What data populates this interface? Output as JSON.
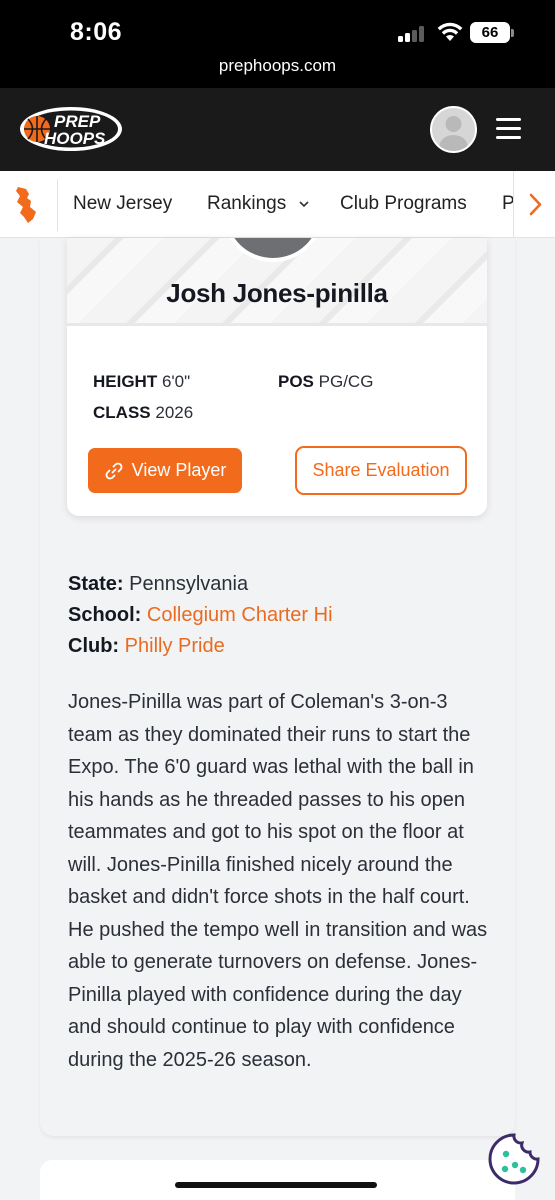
{
  "status_bar": {
    "time": "8:06",
    "url": "prephoops.com",
    "battery": "66"
  },
  "header": {
    "logo_top": "PREP",
    "logo_bottom": "HOOPS",
    "accent_color": "#f26a1b"
  },
  "nav": {
    "items": [
      {
        "label": "New Jersey"
      },
      {
        "label": "Rankings"
      },
      {
        "label": "Club Programs"
      },
      {
        "label": "P"
      }
    ]
  },
  "player": {
    "name": "Josh Jones-pinilla",
    "height_label": "HEIGHT",
    "height_value": "6'0\"",
    "pos_label": "POS",
    "pos_value": "PG/CG",
    "class_label": "CLASS",
    "class_value": "2026",
    "view_button": "View Player",
    "share_button": "Share Evaluation"
  },
  "details": {
    "state_label": "State:",
    "state_value": "Pennsylvania",
    "school_label": "School:",
    "school_value": "Collegium Charter Hi",
    "club_label": "Club:",
    "club_value": "Philly Pride"
  },
  "evaluation": {
    "text": "Jones-Pinilla was part of Coleman's 3-on-3 team as they dominated their runs to start the Expo. The 6'0 guard was lethal with the ball in his hands as he threaded passes to his open teammates and got to his spot on the floor at will. Jones-Pinilla finished nicely around the basket and didn't force shots in the half court. He pushed the tempo well in transition and was able to generate turnovers on defense. Jones-Pinilla played with confidence during the day and should continue to play with confidence during the 2025-26 season."
  }
}
